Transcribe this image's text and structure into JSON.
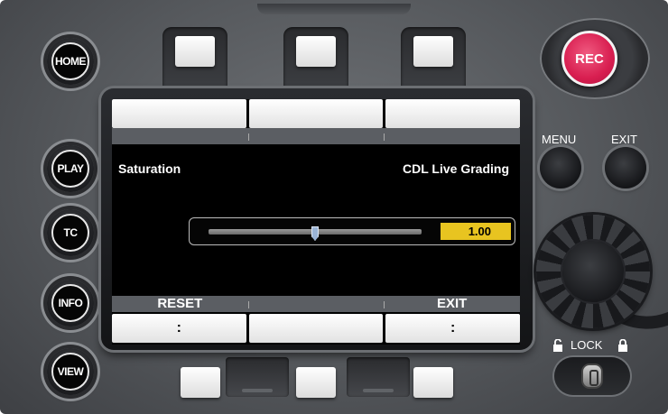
{
  "left_buttons": [
    {
      "label": "HOME"
    },
    {
      "label": "PLAY"
    },
    {
      "label": "TC"
    },
    {
      "label": "INFO"
    },
    {
      "label": "VIEW"
    }
  ],
  "screen": {
    "top_labels": [
      "",
      "",
      ""
    ],
    "left_title": "Saturation",
    "right_title": "CDL Live Grading",
    "slider": {
      "value_text": "1.00",
      "position_fraction": 0.5
    },
    "bottom_labels": [
      "RESET",
      "",
      "EXIT"
    ],
    "bottom_values": [
      ":",
      "",
      ":"
    ]
  },
  "right_controls": {
    "rec_label": "REC",
    "menu_label": "MENU",
    "exit_label": "EXIT",
    "lock_label": "LOCK"
  },
  "colors": {
    "rec": "#d81e50",
    "value_box": "#e8c420",
    "panel": "#55585c"
  }
}
